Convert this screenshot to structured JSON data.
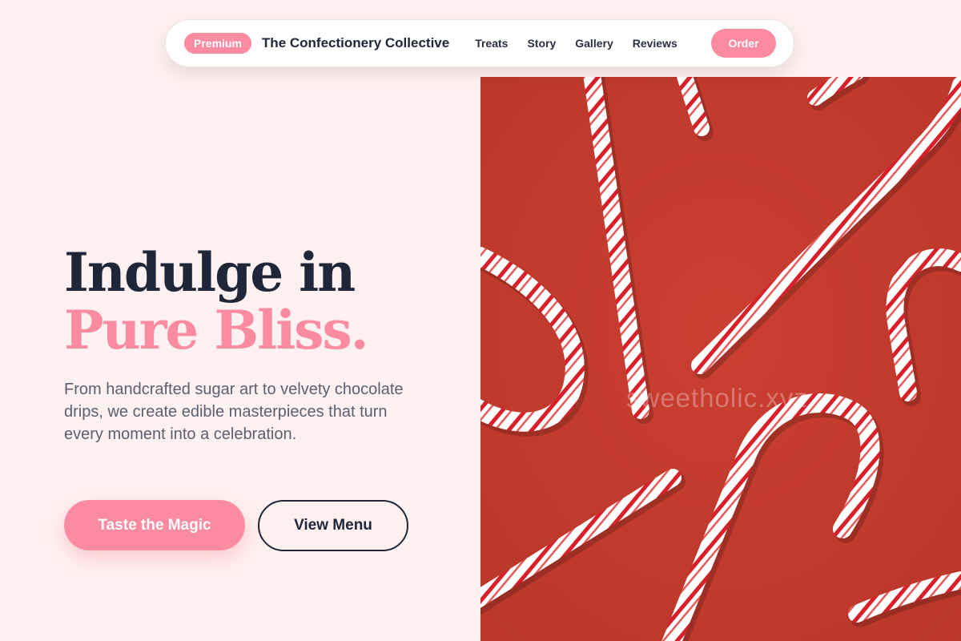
{
  "nav": {
    "badge": "Premium",
    "brand": "The Confectionery Collective",
    "links": [
      {
        "label": "Treats"
      },
      {
        "label": "Story"
      },
      {
        "label": "Gallery"
      },
      {
        "label": "Reviews"
      }
    ],
    "cta": "Order"
  },
  "hero": {
    "title_line1": "Indulge in",
    "title_line2": "Pure Bliss.",
    "description": "From handcrafted sugar art to velvety chocolate drips, we create edible masterpieces that turn every moment into a celebration.",
    "primary_button": "Taste the Magic",
    "secondary_button": "View Menu"
  },
  "image": {
    "subject": "candy canes on red background",
    "watermark": "sweetholic.xyz"
  },
  "colors": {
    "accent": "#fb8ba1",
    "navy": "#1e2638",
    "background": "#fff1f1",
    "image_red": "#c83b2e",
    "cane_stripe": "#d8202b"
  }
}
